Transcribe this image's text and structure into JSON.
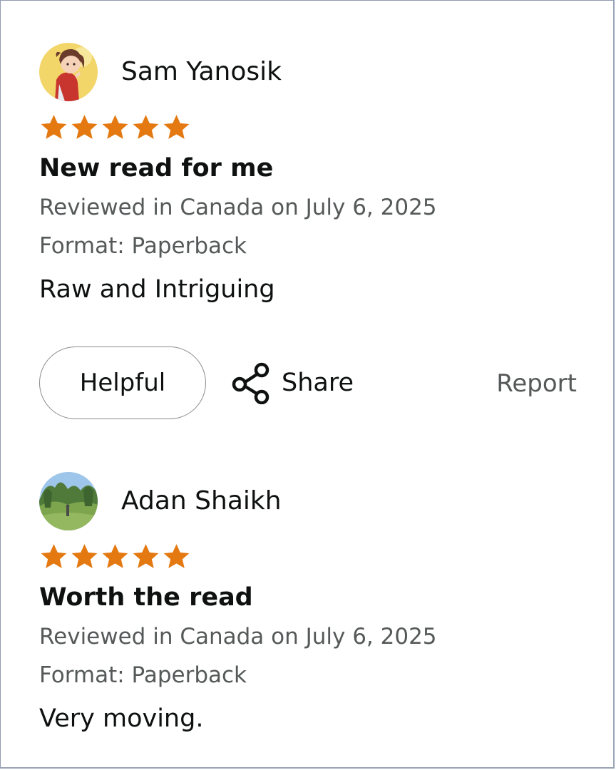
{
  "reviews": [
    {
      "reviewer": "Sam Yanosik",
      "avatar_icon": "anime-girl-avatar",
      "rating": 5,
      "rating_max": 5,
      "title": "New read for me",
      "date_line": "Reviewed in Canada on July 6, 2025",
      "format_line": "Format: Paperback",
      "body": "Raw and Intriguing"
    },
    {
      "reviewer": "Adan Shaikh",
      "avatar_icon": "landscape-photo-avatar",
      "rating": 5,
      "rating_max": 5,
      "title": "Worth the read",
      "date_line": "Reviewed in Canada on July 6, 2025",
      "format_line": "Format: Paperback",
      "body": "Very moving."
    }
  ],
  "actions": {
    "helpful_label": "Helpful",
    "share_label": "Share",
    "share_icon": "share-icon",
    "report_label": "Report"
  },
  "colors": {
    "star": "#e47911",
    "text": "#0f1111",
    "secondary_text": "#565959",
    "button_border": "#888c8c"
  }
}
